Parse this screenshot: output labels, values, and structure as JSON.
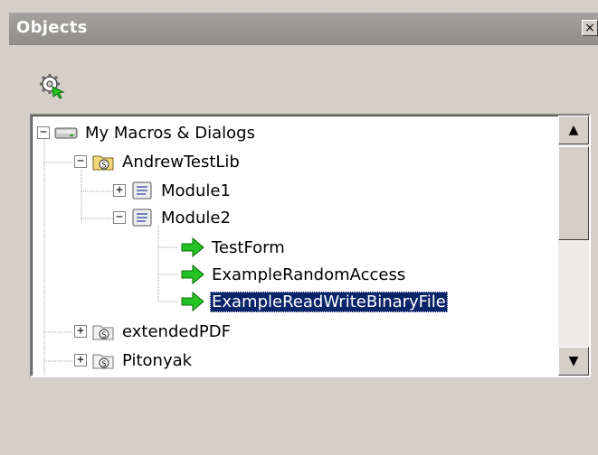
{
  "window": {
    "title": "Objects",
    "close_glyph": "×"
  },
  "toolbar": {
    "icon": "macro-organizer-icon"
  },
  "tree": {
    "nodes": [
      {
        "label": "My Macros & Dialogs",
        "icon": "drive-icon",
        "expander": "−"
      },
      {
        "label": "AndrewTestLib",
        "icon": "library-open-icon",
        "expander": "−"
      },
      {
        "label": "Module1",
        "icon": "module-icon",
        "expander": "+"
      },
      {
        "label": "Module2",
        "icon": "module-icon",
        "expander": "−"
      },
      {
        "label": "TestForm",
        "icon": "macro-arrow-icon"
      },
      {
        "label": "ExampleRandomAccess",
        "icon": "macro-arrow-icon"
      },
      {
        "label": "ExampleReadWriteBinaryFile",
        "icon": "macro-arrow-icon",
        "selected": true
      },
      {
        "label": "extendedPDF",
        "icon": "library-icon",
        "expander": "+"
      },
      {
        "label": "Pitonyak",
        "icon": "library-icon",
        "expander": "+"
      }
    ]
  },
  "scrollbar": {
    "up_glyph": "▲",
    "down_glyph": "▼"
  },
  "colors": {
    "selection": "#0a246a",
    "arrow": "#22c322",
    "titlebar": "#8f8d88"
  }
}
